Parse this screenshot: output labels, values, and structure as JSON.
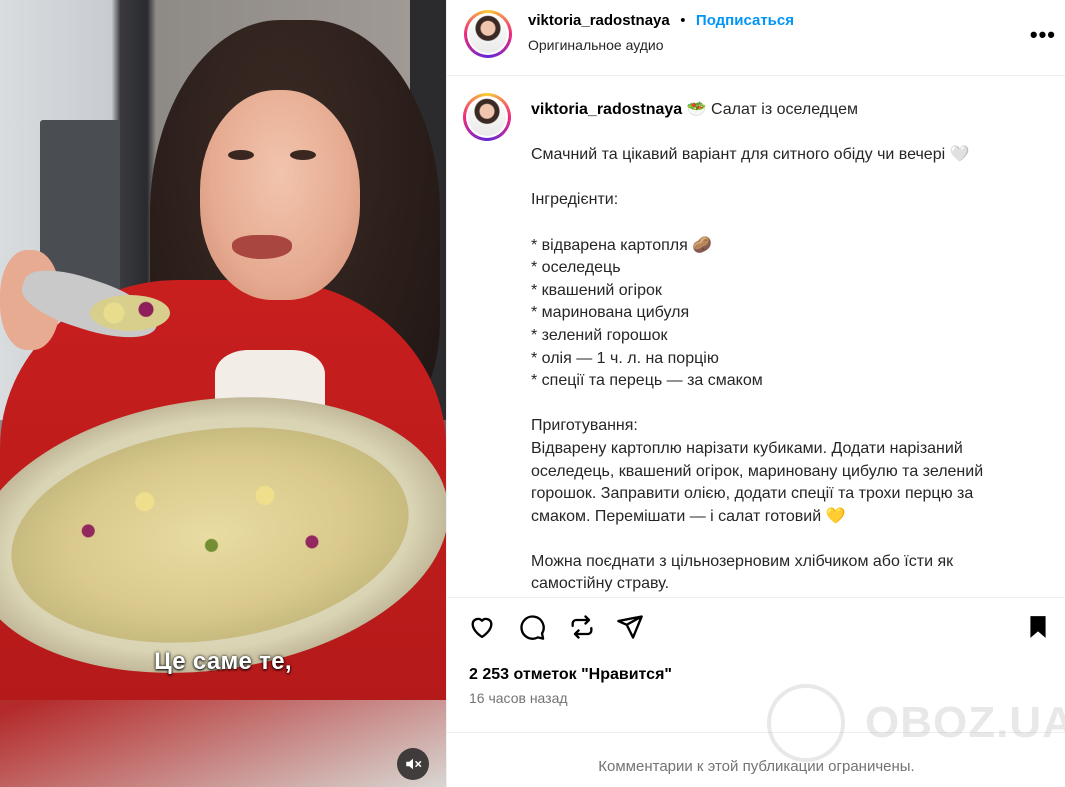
{
  "video": {
    "subtitle": "Це саме те,",
    "mute_icon": "speaker-muted-icon"
  },
  "header": {
    "username": "viktoria_radostnaya",
    "separator": "•",
    "follow_label": "Подписаться",
    "audio": "Оригинальное аудио",
    "more_label": "•••"
  },
  "caption": {
    "username": "viktoria_radostnaya",
    "text": "🥗 Салат із оселедцем\n\nСмачний та цікавий варіант для ситного обіду чи вечері 🤍\n\nІнгредієнти:\n\n* відварена картопля 🥔\n* оселедець\n* квашений огірок\n* маринована цибуля\n* зелений горошок\n* олія — 1 ч. л. на порцію\n* спеції та перець — за смаком\n\nПриготування:\nВідварену картоплю нарізати кубиками. Додати нарізаний оселедець, квашений огірок, мариновану цибулю та зелений горошок. Заправити олією, додати спеції та трохи перцю за смаком. Перемішати — і салат готовий 💛\n\nМожна поєднати з цільнозерновим хлібчиком або їсти як самостійну страву."
  },
  "actions": {
    "like_icon": "heart-icon",
    "comment_icon": "comment-icon",
    "repost_icon": "repost-icon",
    "share_icon": "share-icon",
    "save_icon": "bookmark-icon"
  },
  "likes": "2 253 отметок \"Нравится\"",
  "time": "16 часов назад",
  "footer": "Комментарии к этой публикации ограничены.",
  "watermark": "OBOZ.UA",
  "colors": {
    "follow": "#0095f6",
    "secondary_text": "#737373",
    "border": "#efefef"
  }
}
